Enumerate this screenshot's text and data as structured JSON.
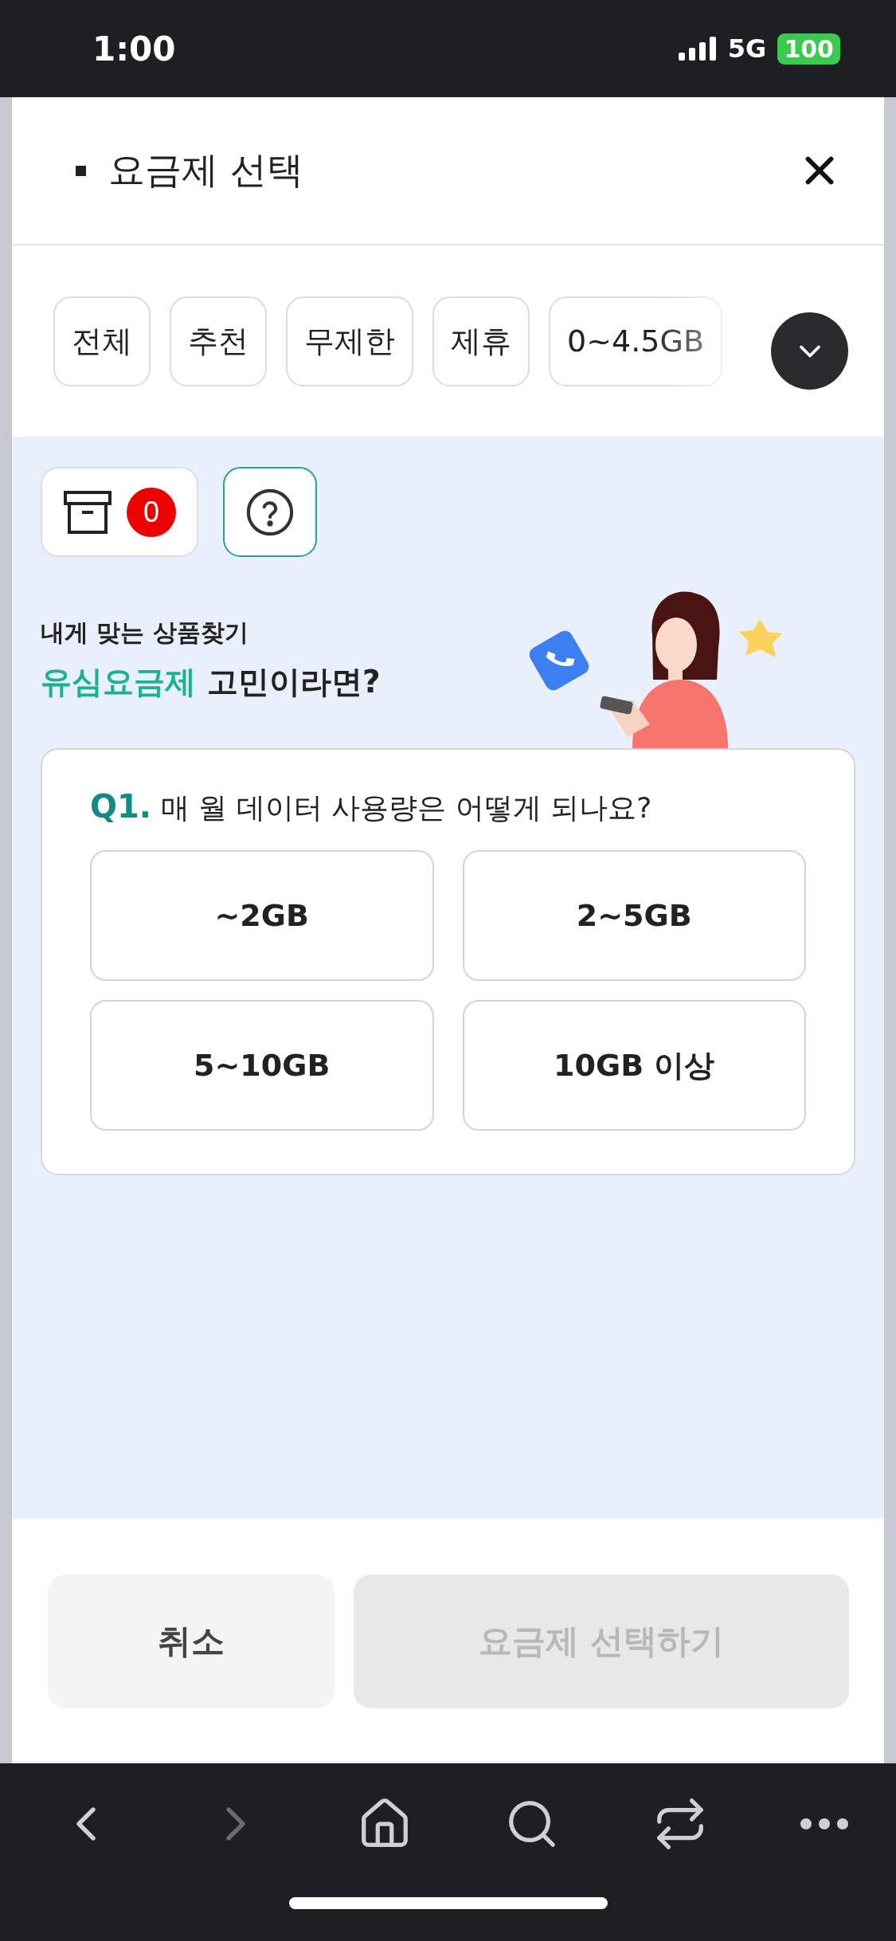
{
  "status_bar": {
    "time": "1:00",
    "network": "5G",
    "battery": "100"
  },
  "header": {
    "title": "요금제 선택"
  },
  "filter_chips": [
    {
      "label": "전체",
      "selected": false
    },
    {
      "label": "추천",
      "selected": false
    },
    {
      "label": "무제한",
      "selected": false
    },
    {
      "label": "제휴",
      "selected": false
    },
    {
      "label": "0~4.5GB",
      "selected": false
    }
  ],
  "tools": {
    "cart_count": "0"
  },
  "banner": {
    "subtitle": "내게 맞는 상품찾기",
    "headline_highlight": "유심요금제",
    "headline_rest": "고민이라면?"
  },
  "question": {
    "number": "Q1.",
    "text": "매 월 데이터 사용량은 어떻게 되나요?",
    "options": [
      {
        "label": "~2GB",
        "selected": false
      },
      {
        "label": "2~5GB",
        "selected": false
      },
      {
        "label": "5~10GB",
        "selected": false
      },
      {
        "label": "10GB 이상",
        "selected": false
      }
    ]
  },
  "actions": [
    {
      "label": "취소",
      "disabled": false
    },
    {
      "label": "요금제 선택하기",
      "disabled": true
    }
  ]
}
